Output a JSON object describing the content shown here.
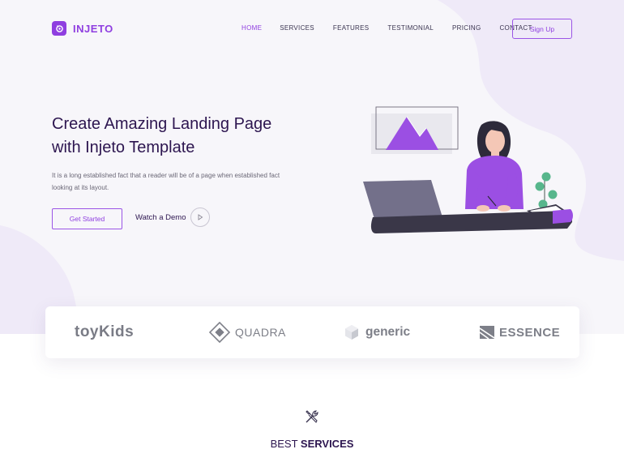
{
  "brand": {
    "name": "INJETO"
  },
  "nav": {
    "items": [
      {
        "label": "HOME",
        "active": true
      },
      {
        "label": "SERVICES",
        "active": false
      },
      {
        "label": "FEATURES",
        "active": false
      },
      {
        "label": "TESTIMONIAL",
        "active": false
      },
      {
        "label": "PRICING",
        "active": false
      },
      {
        "label": "CONTACT",
        "active": false
      }
    ],
    "signup_label": "Sign Up"
  },
  "hero": {
    "title_line1": "Create Amazing Landing Page",
    "title_line2": "with Injeto Template",
    "description": "It is a long established fact that a reader will be of a page when established fact looking at its layout.",
    "cta_label": "Get Started",
    "demo_label": "Watch a Demo"
  },
  "brands": {
    "logos": [
      "toyKids",
      "QUADRA",
      "generic",
      "ESSENCE"
    ]
  },
  "services": {
    "title_light": "BEST ",
    "title_bold": "SERVICES"
  },
  "colors": {
    "accent": "#8f3ee0",
    "heading": "#2d1650",
    "hero_bg": "#f7f6fa",
    "blob": "#efeaf8"
  }
}
